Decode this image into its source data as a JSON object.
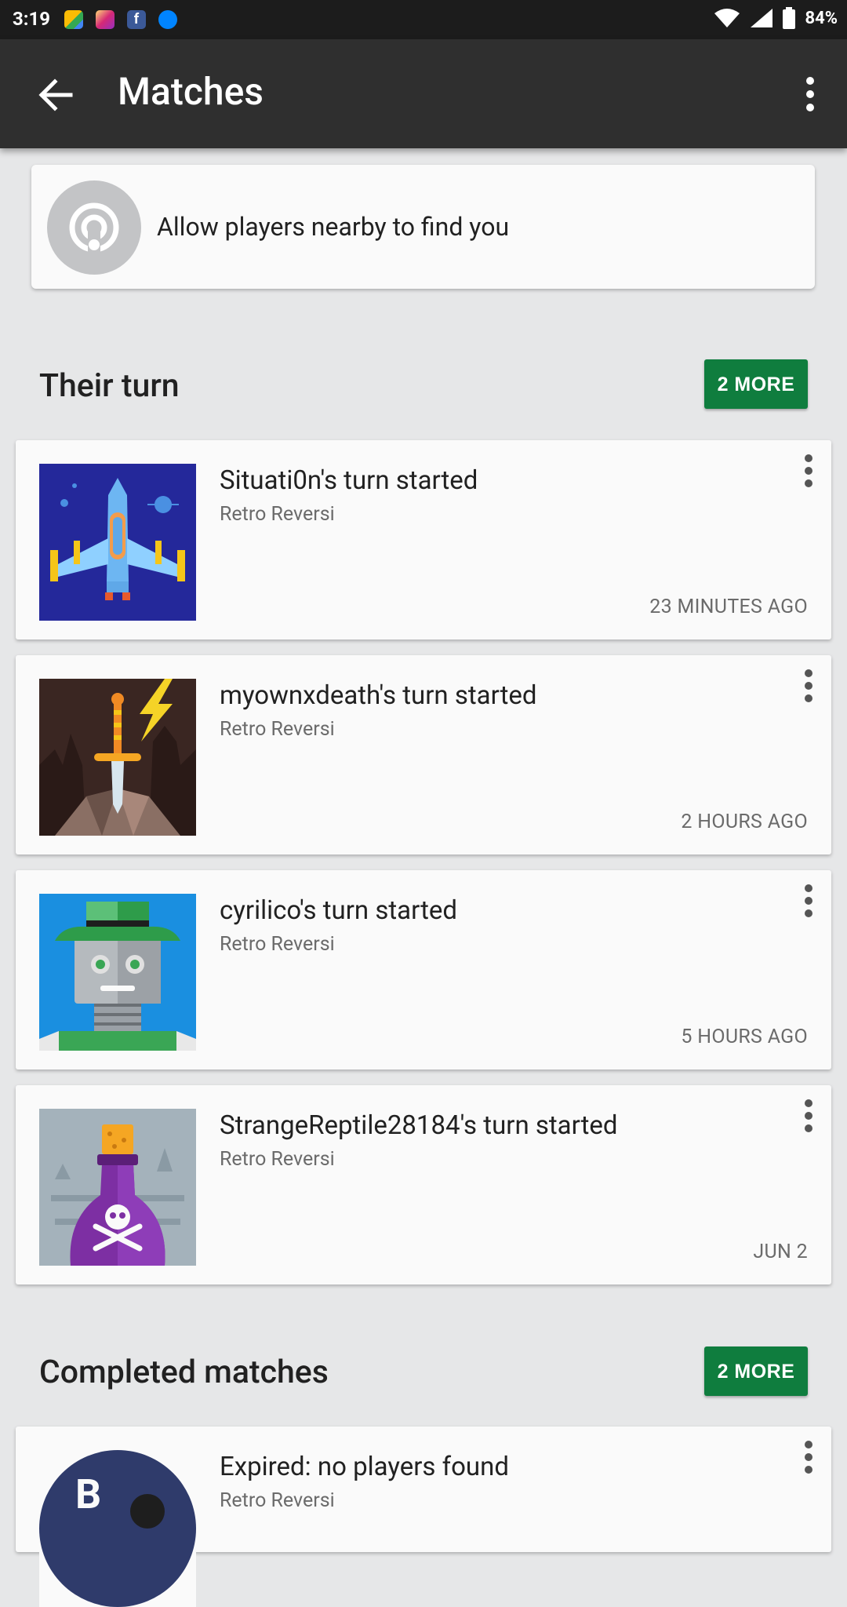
{
  "status_bar": {
    "time": "3:19",
    "battery": "84%"
  },
  "app_bar": {
    "title": "Matches"
  },
  "nearby_card": {
    "label": "Allow players nearby to find you"
  },
  "their_turn": {
    "heading": "Their turn",
    "more_label": "2 MORE",
    "matches": [
      {
        "title": "Situati0n's turn started",
        "game": "Retro Reversi",
        "time": "23 MINUTES AGO",
        "avatar": "spaceship-avatar"
      },
      {
        "title": "myownxdeath's turn started",
        "game": "Retro Reversi",
        "time": "2 HOURS AGO",
        "avatar": "sword-avatar"
      },
      {
        "title": "cyrilico's turn started",
        "game": "Retro Reversi",
        "time": "5 HOURS AGO",
        "avatar": "robot-avatar"
      },
      {
        "title": "StrangeReptile28184's turn started",
        "game": "Retro Reversi",
        "time": "JUN 2",
        "avatar": "poison-bottle-avatar"
      }
    ]
  },
  "completed": {
    "heading": "Completed matches",
    "more_label": "2 MORE",
    "matches": [
      {
        "title": "Expired: no players found",
        "game": "Retro Reversi",
        "avatar_letter": "B"
      }
    ]
  },
  "colors": {
    "accent": "#0f7d3e",
    "app_bar": "#2f2f2f",
    "status_bar": "#1c1c1c"
  }
}
